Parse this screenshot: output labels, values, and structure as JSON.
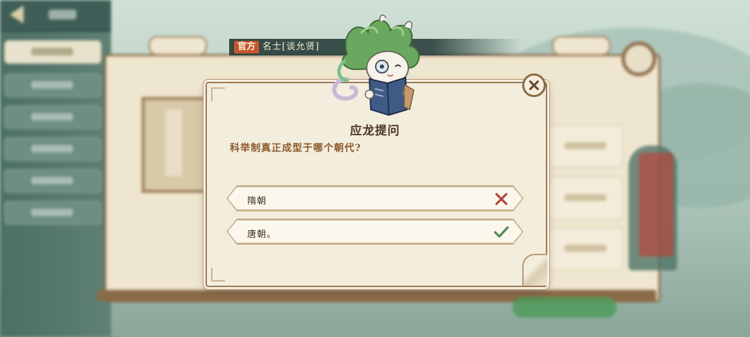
{
  "speaker": {
    "badge": "官方",
    "name": "名士[谈允贤]"
  },
  "dialog": {
    "title": "应龙提问",
    "question": "科举制真正成型于哪个朝代?",
    "options": [
      {
        "label": "隋朝",
        "result": "wrong",
        "mark_icon": "cross-icon"
      },
      {
        "label": "唐朝。",
        "result": "correct",
        "mark_icon": "check-icon"
      }
    ]
  },
  "colors": {
    "badge_bg": "#c4572f",
    "wrong_mark": "#b3453a",
    "correct_mark": "#4f8c57",
    "title_text": "#4a3524",
    "question_text": "#8b5a2b"
  }
}
